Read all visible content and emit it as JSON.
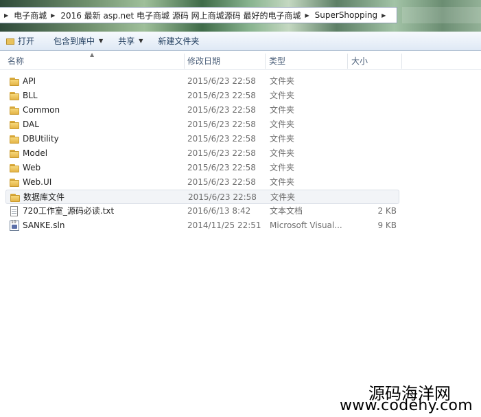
{
  "breadcrumb": [
    "电子商城",
    "2016 最新 asp.net 电子商城 源码 网上商城源码 最好的电子商城",
    "SuperShopping"
  ],
  "toolbar": {
    "open": "打开",
    "include_in_library": "包含到库中",
    "share": "共享",
    "new_folder": "新建文件夹"
  },
  "columns": {
    "name": "名称",
    "modified": "修改日期",
    "type": "类型",
    "size": "大小"
  },
  "files": [
    {
      "name": "API",
      "modified": "2015/6/23 22:58",
      "type": "文件夹",
      "size": "",
      "icon": "folder-icon"
    },
    {
      "name": "BLL",
      "modified": "2015/6/23 22:58",
      "type": "文件夹",
      "size": "",
      "icon": "folder-icon"
    },
    {
      "name": "Common",
      "modified": "2015/6/23 22:58",
      "type": "文件夹",
      "size": "",
      "icon": "folder-icon"
    },
    {
      "name": "DAL",
      "modified": "2015/6/23 22:58",
      "type": "文件夹",
      "size": "",
      "icon": "folder-icon"
    },
    {
      "name": "DBUtility",
      "modified": "2015/6/23 22:58",
      "type": "文件夹",
      "size": "",
      "icon": "folder-icon"
    },
    {
      "name": "Model",
      "modified": "2015/6/23 22:58",
      "type": "文件夹",
      "size": "",
      "icon": "folder-icon"
    },
    {
      "name": "Web",
      "modified": "2015/6/23 22:58",
      "type": "文件夹",
      "size": "",
      "icon": "folder-icon"
    },
    {
      "name": "Web.UI",
      "modified": "2015/6/23 22:58",
      "type": "文件夹",
      "size": "",
      "icon": "folder-icon"
    },
    {
      "name": "数据库文件",
      "modified": "2015/6/23 22:58",
      "type": "文件夹",
      "size": "",
      "icon": "folder-icon",
      "selected": true
    },
    {
      "name": "720工作室_源码必读.txt",
      "modified": "2016/6/13 8:42",
      "type": "文本文档",
      "size": "2 KB",
      "icon": "txt-icon"
    },
    {
      "name": "SANKE.sln",
      "modified": "2014/11/25 22:51",
      "type": "Microsoft Visual...",
      "size": "9 KB",
      "icon": "sln-icon"
    }
  ],
  "watermark": {
    "line1": "源码海洋网",
    "line2": "www.codehy.com"
  }
}
